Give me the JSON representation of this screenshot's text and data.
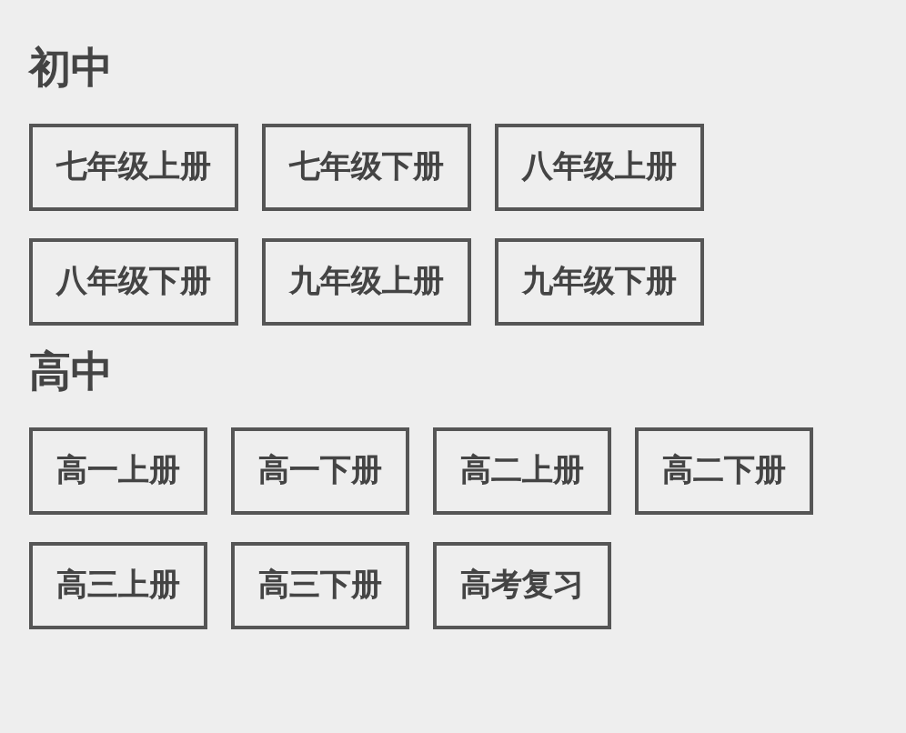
{
  "sections": [
    {
      "title": "初中",
      "buttons": [
        "七年级上册",
        "七年级下册",
        "八年级上册",
        "八年级下册",
        "九年级上册",
        "九年级下册"
      ]
    },
    {
      "title": "高中",
      "buttons": [
        "高一上册",
        "高一下册",
        "高二上册",
        "高二下册",
        "高三上册",
        "高三下册",
        "高考复习"
      ]
    }
  ]
}
